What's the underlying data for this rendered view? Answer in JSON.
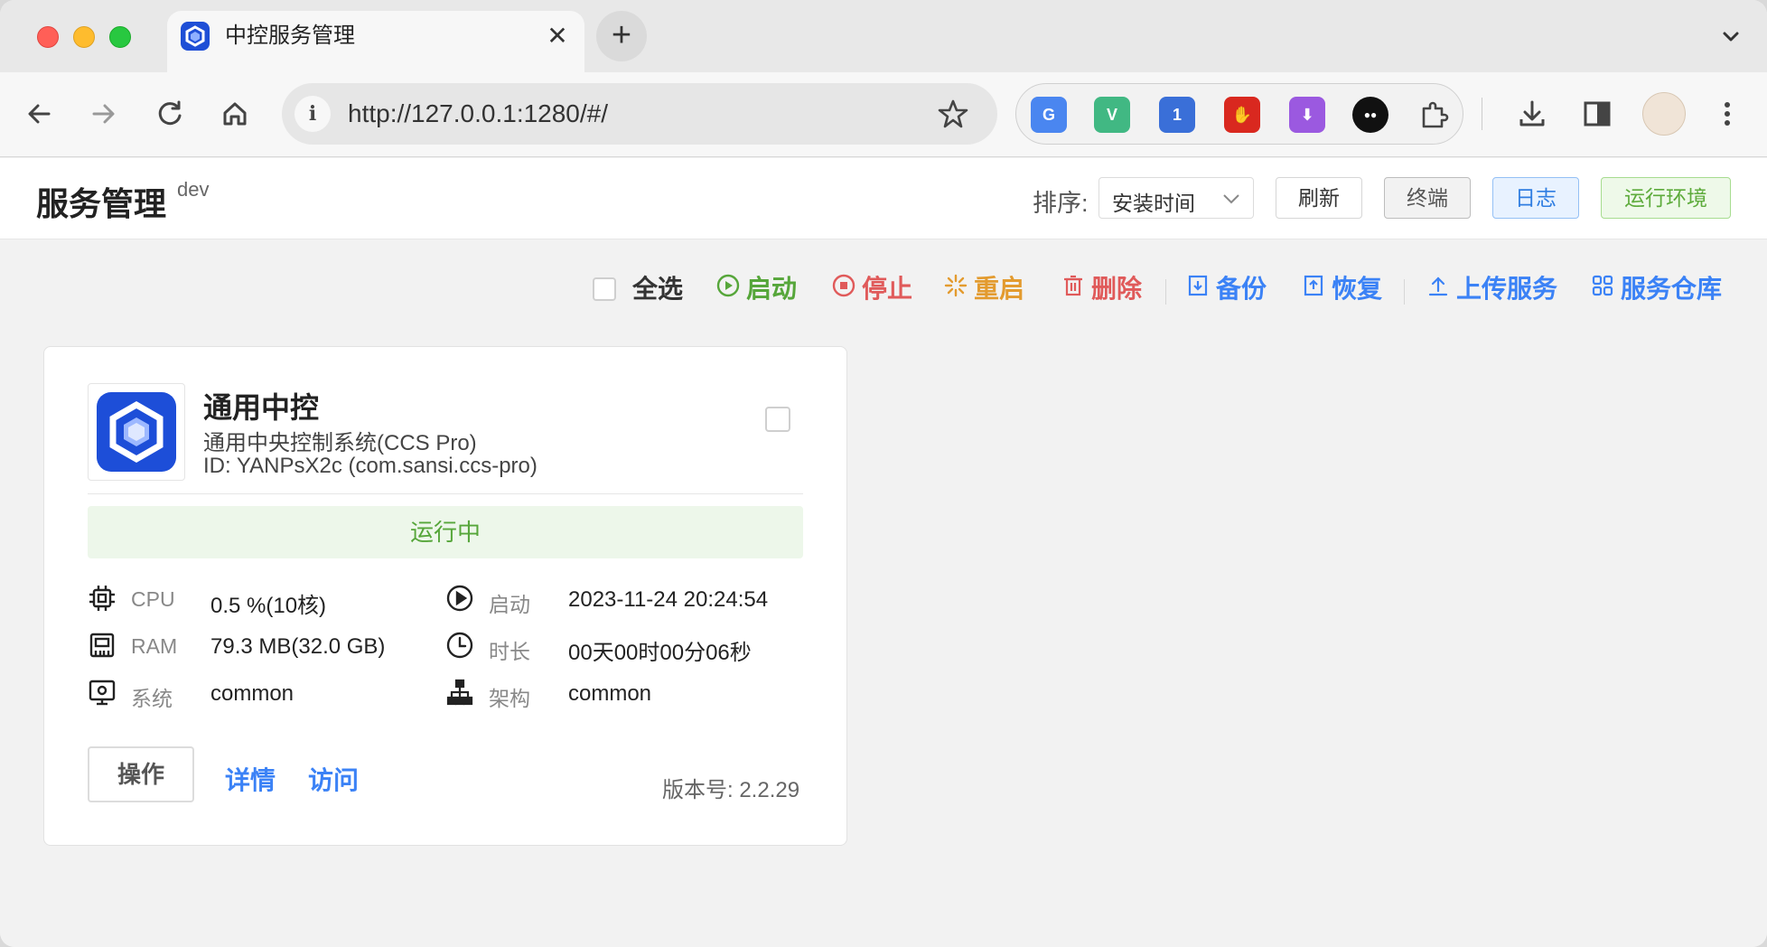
{
  "browser": {
    "tab_title": "中控服务管理",
    "tab_close": "✕",
    "new_tab": "+",
    "tablist": "⌄",
    "url": "http://127.0.0.1:1280/#/",
    "info_glyph": "i",
    "extensions": [
      {
        "name": "google-translate-extension-icon",
        "glyph": "G",
        "color": "#4a86f0"
      },
      {
        "name": "vue-devtools-extension-icon",
        "glyph": "V",
        "color": "#41b883"
      },
      {
        "name": "password-manager-extension-icon",
        "glyph": "1",
        "color": "#3a6fd8"
      },
      {
        "name": "adblock-extension-icon",
        "glyph": "✋",
        "color": "#d9281f"
      },
      {
        "name": "download-helper-extension-icon",
        "glyph": "⬇",
        "color": "#9b59e0"
      },
      {
        "name": "tampermonkey-extension-icon",
        "glyph": "●●",
        "color": "#111111"
      }
    ]
  },
  "header": {
    "title": "服务管理",
    "env": "dev",
    "sort_label": "排序:",
    "sort_value": "安装时间",
    "refresh": "刷新",
    "terminal": "终端",
    "log": "日志",
    "runtime_env": "运行环境"
  },
  "actions": {
    "select_all": "全选",
    "start": "启动",
    "stop": "停止",
    "restart": "重启",
    "delete": "删除",
    "backup": "备份",
    "restore": "恢复",
    "upload": "上传服务",
    "repository": "服务仓库",
    "colors": {
      "start": "#56a63a",
      "stop": "#e05a5a",
      "restart": "#e39b2f",
      "delete": "#e05a5a",
      "blue": "#3b82f6"
    }
  },
  "service": {
    "name": "通用中控",
    "description": "通用中央控制系统(CCS Pro)",
    "id_line": "ID: YANPsX2c (com.sansi.ccs-pro)",
    "status": "运行中",
    "stats": {
      "cpu_label": "CPU",
      "cpu_value": "0.5 %(10核)",
      "ram_label": "RAM",
      "ram_value": "79.3 MB(32.0 GB)",
      "system_label": "系统",
      "system_value": "common",
      "start_label": "启动",
      "start_value": "2023-11-24 20:24:54",
      "uptime_label": "时长",
      "uptime_value": "00天00时00分06秒",
      "arch_label": "架构",
      "arch_value": "common"
    },
    "operate": "操作",
    "details": "详情",
    "visit": "访问",
    "version": "版本号: 2.2.29"
  }
}
